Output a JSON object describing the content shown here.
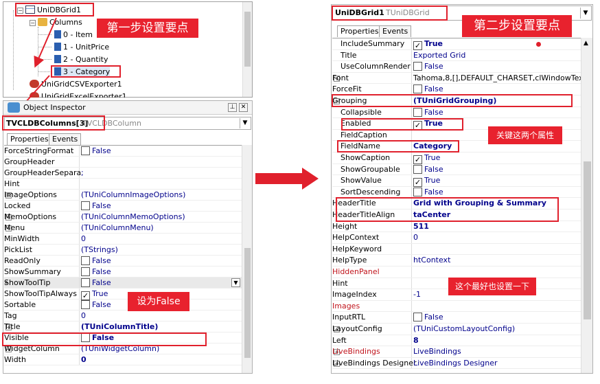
{
  "left": {
    "tree": {
      "root": "UniDBGrid1",
      "columns": "Columns",
      "items": [
        "0 - Item",
        "1 - UnitPrice",
        "2 - Quantity",
        "3 - Category"
      ],
      "exporter1": "UniGridCSVExporter1",
      "exporter2": "UniGridExcelExporter1"
    },
    "inspector": {
      "title": "Object Inspector",
      "object_name": "TVCLDBColumns[3]",
      "object_type": "TVCLDBColumn",
      "tabs": [
        "Properties",
        "Events"
      ],
      "rows": [
        {
          "name": "ForceStringFormat",
          "value": "False",
          "check": "empty"
        },
        {
          "name": "GroupHeader",
          "value": ""
        },
        {
          "name": "GroupHeaderSepara",
          "value": ";"
        },
        {
          "name": "Hint",
          "value": ""
        },
        {
          "name": "ImageOptions",
          "value": "(TUniColumnImageOptions)",
          "expand": true
        },
        {
          "name": "Locked",
          "value": "False",
          "check": "empty"
        },
        {
          "name": "MemoOptions",
          "value": "(TUniColumnMemoOptions)",
          "expand": true
        },
        {
          "name": "Menu",
          "value": "(TUniColumnMenu)",
          "expand": true
        },
        {
          "name": "MinWidth",
          "value": "0"
        },
        {
          "name": "PickList",
          "value": "(TStrings)"
        },
        {
          "name": "ReadOnly",
          "value": "False",
          "check": "empty"
        },
        {
          "name": "ShowSummary",
          "value": "False",
          "check": "empty"
        },
        {
          "name": "ShowToolTip",
          "value": "False",
          "check": "empty",
          "selected": true
        },
        {
          "name": "ShowToolTipAlways",
          "value": "True",
          "check": "checked"
        },
        {
          "name": "Sortable",
          "value": "False",
          "check": "empty"
        },
        {
          "name": "Tag",
          "value": "0"
        },
        {
          "name": "Title",
          "value": "(TUniColumnTitle)",
          "expand": true,
          "bold": true
        },
        {
          "name": "Visible",
          "value": "False",
          "check": "empty",
          "bold": true
        },
        {
          "name": "WidgetColumn",
          "value": "(TUniWidgetColumn)",
          "expand": true
        },
        {
          "name": "Width",
          "value": "0",
          "bold": true
        }
      ]
    },
    "annotations": {
      "step1": "第一步设置要点",
      "set_false": "设为False"
    }
  },
  "right": {
    "inspector": {
      "object_name": "UniDBGrid1",
      "object_type": "TUniDBGrid",
      "tabs": [
        "Properties",
        "Events"
      ],
      "rows": [
        {
          "name": "IncludeSummary",
          "value": "True",
          "check": "checked",
          "bold": true
        },
        {
          "name": "Title",
          "value": "Exported Grid"
        },
        {
          "name": "UseColumnRender",
          "value": "False",
          "check": "empty"
        },
        {
          "name": "Font",
          "value": "Tahoma,8,[],DEFAULT_CHARSET,clWindowText",
          "expand": true,
          "black": true,
          "level": 0
        },
        {
          "name": "ForceFit",
          "value": "False",
          "check": "empty",
          "level": 0
        },
        {
          "name": "Grouping",
          "value": "(TUniGridGrouping)",
          "collapse": true,
          "bold": true,
          "level": 0
        },
        {
          "name": "Collapsible",
          "value": "False",
          "check": "empty"
        },
        {
          "name": "Enabled",
          "value": "True",
          "check": "checked",
          "bold": true
        },
        {
          "name": "FieldCaption",
          "value": ""
        },
        {
          "name": "FieldName",
          "value": "Category",
          "bold": true
        },
        {
          "name": "ShowCaption",
          "value": "True",
          "check": "checked"
        },
        {
          "name": "ShowGroupable",
          "value": "False",
          "check": "empty"
        },
        {
          "name": "ShowValue",
          "value": "True",
          "check": "checked"
        },
        {
          "name": "SortDescending",
          "value": "False",
          "check": "empty"
        },
        {
          "name": "HeaderTitle",
          "value": "Grid with Grouping & Summary",
          "bold": true,
          "level": 0
        },
        {
          "name": "HeaderTitleAlign",
          "value": "taCenter",
          "bold": true,
          "level": 0
        },
        {
          "name": "Height",
          "value": "511",
          "bold": true,
          "level": 0
        },
        {
          "name": "HelpContext",
          "value": "0",
          "level": 0
        },
        {
          "name": "HelpKeyword",
          "value": "",
          "level": 0
        },
        {
          "name": "HelpType",
          "value": "htContext",
          "level": 0
        },
        {
          "name": "HiddenPanel",
          "value": "",
          "muted": true,
          "level": 0
        },
        {
          "name": "Hint",
          "value": "",
          "level": 0
        },
        {
          "name": "ImageIndex",
          "value": "-1",
          "level": 0
        },
        {
          "name": "Images",
          "value": "",
          "muted": true,
          "level": 0
        },
        {
          "name": "InputRTL",
          "value": "False",
          "check": "empty",
          "level": 0
        },
        {
          "name": "LayoutConfig",
          "value": "(TUniCustomLayoutConfig)",
          "expand": true,
          "level": 0
        },
        {
          "name": "Left",
          "value": "8",
          "bold": true,
          "level": 0
        },
        {
          "name": "LiveBindings",
          "value": "LiveBindings",
          "expand": true,
          "muted": true,
          "level": 0
        },
        {
          "name": "LiveBindings Designer",
          "value": "LiveBindings Designer",
          "expand": true,
          "level": 0
        }
      ]
    },
    "annotations": {
      "step2": "第二步设置要点",
      "key_props": "关键这两个属性",
      "best_set": "这个最好也设置一下"
    }
  },
  "colors": {
    "accent_red": "#e8222e",
    "value_blue": "#00008b"
  }
}
